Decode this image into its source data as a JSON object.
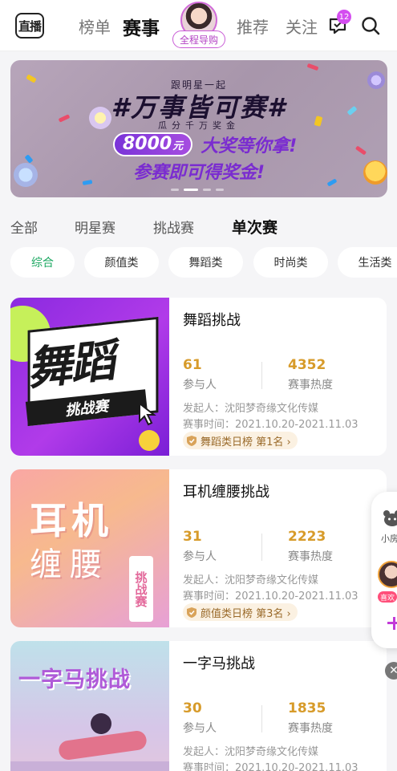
{
  "header": {
    "live_button": "直播",
    "tabs": [
      "榜单",
      "赛事"
    ],
    "avatar_label": "全程导购",
    "right_tabs": [
      "推荐",
      "关注"
    ],
    "message_badge": "12"
  },
  "banner": {
    "subtitle": "跟明星一起",
    "title": "#万事皆可赛#",
    "tagline": "瓜分千万奖金",
    "prize_amount": "8000",
    "prize_unit": "元",
    "prize_text": "大奖等你拿!",
    "cta": "参赛即可得奖金!",
    "active_slide": 1,
    "slide_count": 4
  },
  "category_tabs": [
    "全部",
    "明星赛",
    "挑战赛",
    "单次赛"
  ],
  "filter_chips": [
    "综合",
    "颜值类",
    "舞蹈类",
    "时尚类",
    "生活类"
  ],
  "cards": [
    {
      "title": "舞蹈挑战",
      "thumb_title": "舞蹈",
      "thumb_sub": "挑战赛",
      "participants": "61",
      "participants_label": "参与人",
      "heat": "4352",
      "heat_label": "赛事热度",
      "organizer": "发起人：沈阳梦奇缘文化传媒",
      "time": "赛事时间：2021.10.20-2021.11.03",
      "rank": "舞蹈类日榜 第1名 ›"
    },
    {
      "title": "耳机缠腰挑战",
      "thumb_title": "耳机",
      "thumb_title2": "缠腰",
      "thumb_sub": "挑战赛",
      "participants": "31",
      "participants_label": "参与人",
      "heat": "2223",
      "heat_label": "赛事热度",
      "organizer": "发起人：沈阳梦奇缘文化传媒",
      "time": "赛事时间：2021.10.20-2021.11.03",
      "rank": "颜值类日榜 第3名 ›"
    },
    {
      "title": "一字马挑战",
      "thumb_title": "一字马挑战",
      "participants": "30",
      "participants_label": "参与人",
      "heat": "1835",
      "heat_label": "赛事热度",
      "organizer": "发起人：沈阳梦奇缘文化传媒",
      "time": "赛事时间：2021.10.20-2021.11.03"
    }
  ],
  "float_widget": {
    "label1": "小房",
    "label2": "喜欢"
  },
  "colors": {
    "accent_green": "#1aa760",
    "stat_gold": "#d79b2a",
    "purple": "#7a2cd0"
  }
}
